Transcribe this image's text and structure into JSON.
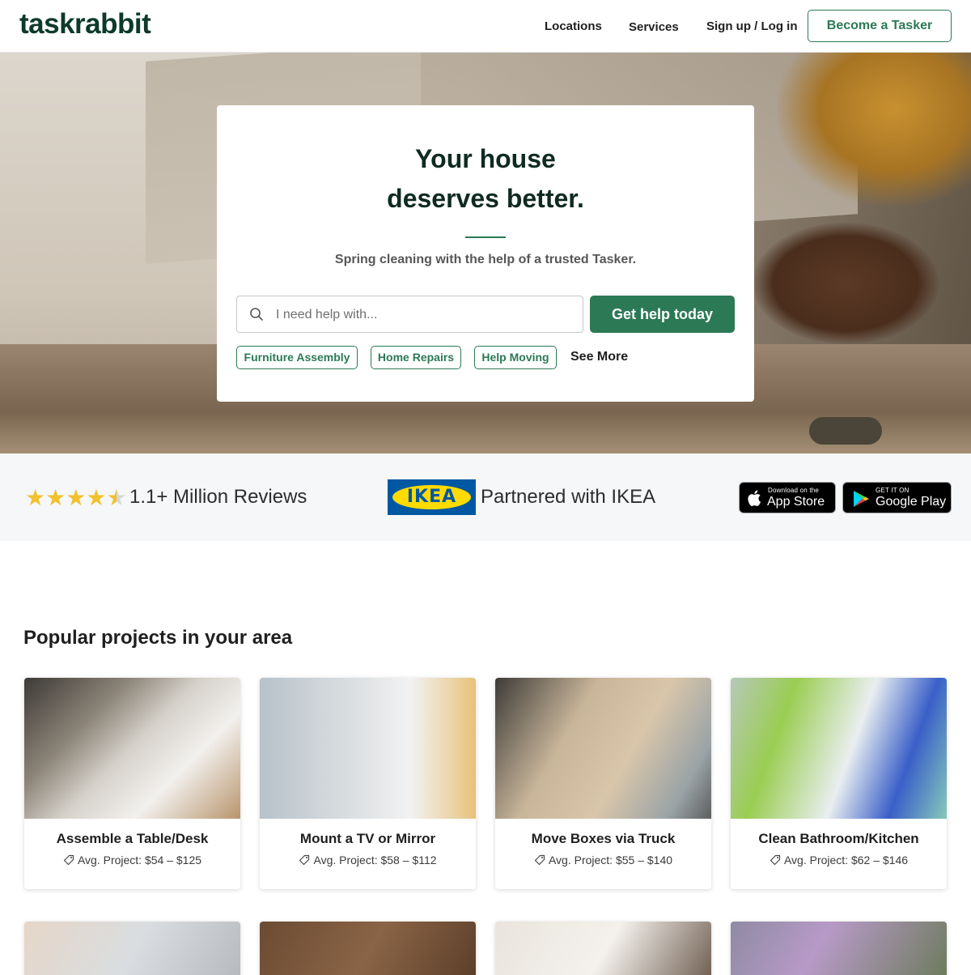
{
  "header": {
    "logo": "taskrabbit",
    "nav": [
      "Locations",
      "Services",
      "Sign up / Log in"
    ],
    "cta": "Become a Tasker"
  },
  "hero": {
    "title_line1": "Your house",
    "title_line2": "deserves better.",
    "subtitle": "Spring cleaning with the help of a trusted Tasker.",
    "search_placeholder": "I need help with...",
    "search_button": "Get help today",
    "chips": [
      "Furniture Assembly",
      "Home Repairs",
      "Help Moving"
    ],
    "see_more": "See More"
  },
  "trust": {
    "rating": 4.5,
    "reviews_text": "1.1+ Million Reviews",
    "ikea_logo_text": "IKEA",
    "partner_text": "Partnered with IKEA",
    "app_store_small": "Download on the",
    "app_store_big": "App Store",
    "google_play_small": "GET IT ON",
    "google_play_big": "Google Play"
  },
  "projects": {
    "title": "Popular projects in your area",
    "cards": [
      {
        "title": "Assemble a Table/Desk",
        "price": "Avg. Project: $54 – $125"
      },
      {
        "title": "Mount a TV or Mirror",
        "price": "Avg. Project: $58 – $112"
      },
      {
        "title": "Move Boxes via Truck",
        "price": "Avg. Project: $55 – $140"
      },
      {
        "title": "Clean Bathroom/Kitchen",
        "price": "Avg. Project: $62 – $146"
      }
    ]
  },
  "colors": {
    "brand_green": "#2b7a55",
    "logo_dark_green": "#0d3a2b",
    "star_yellow": "#f2c12e",
    "ikea_blue": "#0058a3",
    "ikea_yellow": "#ffdb00"
  }
}
